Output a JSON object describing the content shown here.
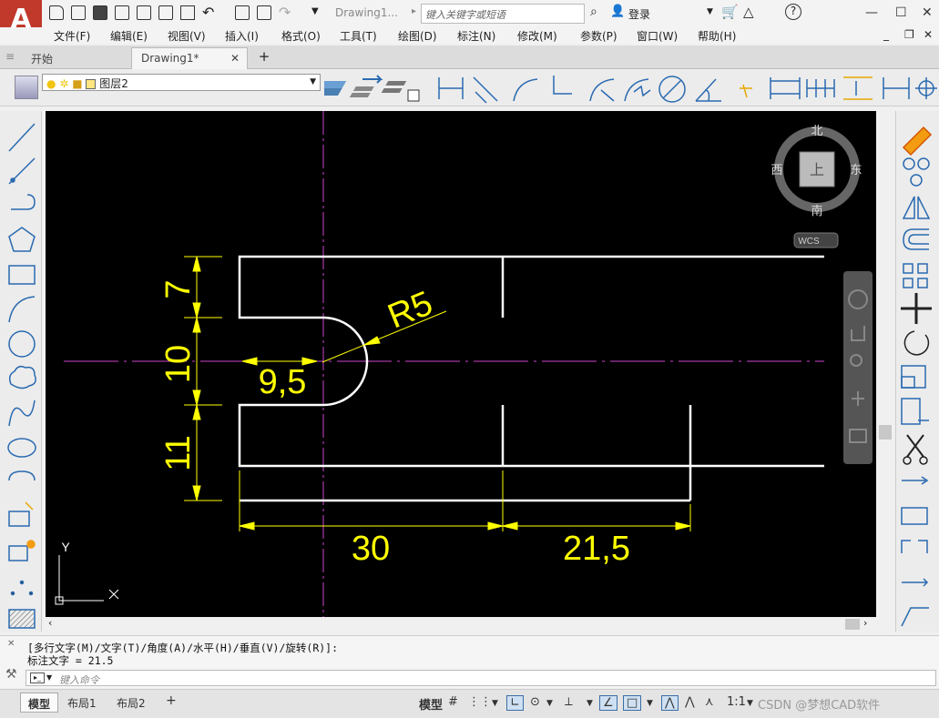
{
  "app": {
    "logo_letter": "A",
    "doc_title": "Drawing1...",
    "search_placeholder": "键入关键字或短语",
    "login": "登录",
    "help": "?"
  },
  "menu": [
    "文件(F)",
    "编辑(E)",
    "视图(V)",
    "插入(I)",
    "格式(O)",
    "工具(T)",
    "绘图(D)",
    "标注(N)",
    "修改(M)",
    "参数(P)",
    "窗口(W)",
    "帮助(H)"
  ],
  "tabs": {
    "start": "开始",
    "drawing": "Drawing1*",
    "close": "✕",
    "add": "+"
  },
  "layer": {
    "name": "图层2"
  },
  "viewcube": {
    "north": "北",
    "south": "南",
    "east": "东",
    "west": "西",
    "face": "上",
    "wcs": "WCS"
  },
  "ucs": {
    "x": "X",
    "y": "Y"
  },
  "dimensions": {
    "d7": "7",
    "d10": "10",
    "d11": "11",
    "d95": "9,5",
    "r5": "R5",
    "d30": "30",
    "d215": "21,5"
  },
  "command": {
    "line1": "[多行文字(M)/文字(T)/角度(A)/水平(H)/垂直(V)/旋转(R)]:",
    "line2": "标注文字 = 21.5",
    "placeholder": "键入命令"
  },
  "layouts": {
    "model": "模型",
    "layout1": "布局1",
    "layout2": "布局2",
    "add": "+"
  },
  "status": {
    "model": "模型",
    "scale": "1:1",
    "watermark": "CSDN @梦想CAD软件"
  },
  "colors": {
    "dim": "#ffff00",
    "center": "#cc44cc",
    "geometry": "#ffffff",
    "canvas": "#000000",
    "logo": "#c0392b"
  }
}
